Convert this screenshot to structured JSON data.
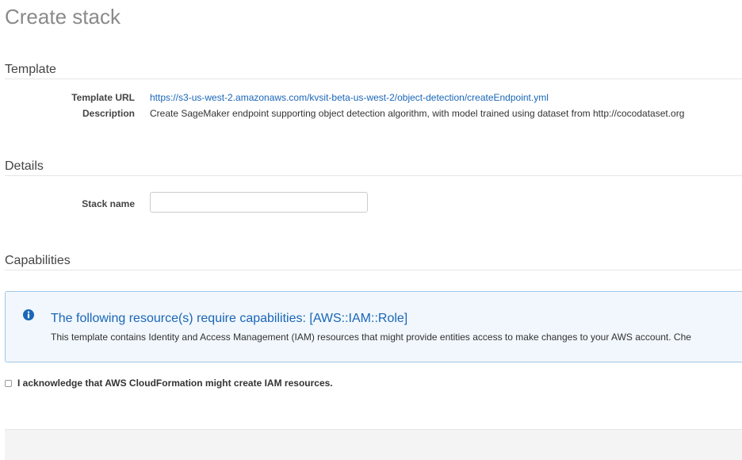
{
  "page": {
    "title": "Create stack"
  },
  "template_section": {
    "heading": "Template",
    "template_url_label": "Template URL",
    "template_url_value": "https://s3-us-west-2.amazonaws.com/kvsit-beta-us-west-2/object-detection/createEndpoint.yml",
    "description_label": "Description",
    "description_value": "Create SageMaker endpoint supporting object detection algorithm, with model trained using dataset from http://cocodataset.org"
  },
  "details_section": {
    "heading": "Details",
    "stack_name_label": "Stack name",
    "stack_name_value": "",
    "stack_name_placeholder": ""
  },
  "capabilities_section": {
    "heading": "Capabilities",
    "info_icon": "info-circle-icon",
    "info_title": "The following resource(s) require capabilities: [AWS::IAM::Role]",
    "info_text": "This template contains Identity and Access Management (IAM) resources that might provide entities access to make changes to your AWS account. Che",
    "acknowledge_label": "I acknowledge that AWS CloudFormation might create IAM resources.",
    "acknowledge_checked": false
  },
  "colors": {
    "link": "#1a66b8",
    "info_background": "#f1f7fc",
    "info_border": "#9fc8e8",
    "title_gray": "#8a8a8a"
  }
}
